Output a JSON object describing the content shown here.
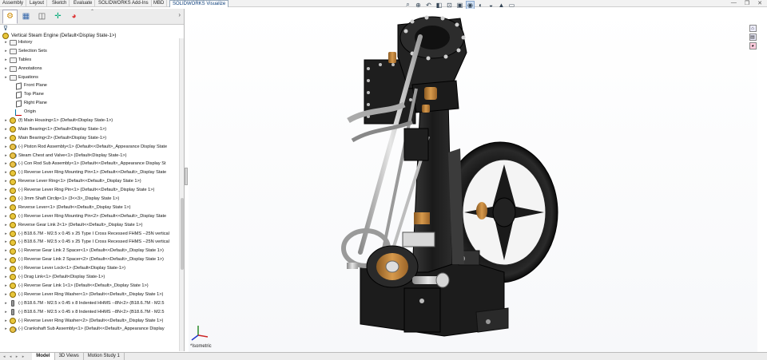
{
  "ribbon": {
    "tabs": [
      "Assembly",
      "Layout",
      "Sketch",
      "Evaluate",
      "SOLIDWORKS Add-Ins",
      "MBD",
      "SOLIDWORKS Visualize"
    ],
    "active_tab": "SOLIDWORKS Visualize"
  },
  "heads_up_toolbar": {
    "icons": [
      "zoom-to-fit-icon",
      "zoom-area-icon",
      "previous-view-icon",
      "section-view-icon",
      "dynamic-annotation-icon",
      "view-orientation-icon",
      "display-style-icon",
      "hide-show-items-icon",
      "edit-appearance-icon",
      "apply-scene-icon",
      "view-settings-icon"
    ]
  },
  "feature_manager": {
    "tabs": [
      "feature-manager-icon",
      "property-manager-icon",
      "configuration-manager-icon",
      "dimxpert-manager-icon",
      "display-manager-icon"
    ],
    "root": "Vertical Steam Engine  (Default<Display State-1>)",
    "items": [
      {
        "label": "History",
        "icon": "folder",
        "level": 1,
        "expandable": true
      },
      {
        "label": "Selection Sets",
        "icon": "folder",
        "level": 1,
        "expandable": true
      },
      {
        "label": "Tables",
        "icon": "folder",
        "level": 1,
        "expandable": true
      },
      {
        "label": "Annotations",
        "icon": "folder",
        "level": 1,
        "expandable": true
      },
      {
        "label": "Equations",
        "icon": "folder",
        "level": 1,
        "expandable": true
      },
      {
        "label": "Front Plane",
        "icon": "plane",
        "level": 2,
        "expandable": false
      },
      {
        "label": "Top Plane",
        "icon": "plane",
        "level": 2,
        "expandable": false
      },
      {
        "label": "Right Plane",
        "icon": "plane",
        "level": 2,
        "expandable": false
      },
      {
        "label": "Origin",
        "icon": "origin",
        "level": 2,
        "expandable": false
      },
      {
        "label": "(f) Main Housing<1> (Default<Display State-1>)",
        "icon": "gear",
        "level": 1,
        "expandable": true
      },
      {
        "label": "Main Bearing<1> (Default<Display State-1>)",
        "icon": "gear",
        "level": 1,
        "expandable": true
      },
      {
        "label": "Main Bearing<2> (Default<Display State-1>)",
        "icon": "gear",
        "level": 1,
        "expandable": true
      },
      {
        "label": "(-) Piston Rod Assembly<1> (Default<<Default>_Appearance Display State",
        "icon": "sub",
        "level": 1,
        "expandable": true
      },
      {
        "label": "Steam Chest and Valve<1> (Default<Display State-1>)",
        "icon": "sub",
        "level": 1,
        "expandable": true
      },
      {
        "label": "(-) Con Rod Sub Assembly<1> (Default<<Default>_Appearance Display St",
        "icon": "sub",
        "level": 1,
        "expandable": true
      },
      {
        "label": "(-) Reverse Lever Ring Mounting Pin<1> (Default<<Default>_Display State",
        "icon": "gear",
        "level": 1,
        "expandable": true
      },
      {
        "label": "Reverse Lever Ring<1> (Default<<Default>_Display State 1>)",
        "icon": "gear",
        "level": 1,
        "expandable": true
      },
      {
        "label": "(-) Reverse Lever Ring Pin<1> (Default<<Default>_Display State 1>)",
        "icon": "gear",
        "level": 1,
        "expandable": true
      },
      {
        "label": "(-) 3mm Shaft Circlip<1> (3<<3>_Display State 1>)",
        "icon": "gear",
        "level": 1,
        "expandable": true
      },
      {
        "label": "Reverse Lever<1> (Default<<Default>_Display State 1>)",
        "icon": "gear",
        "level": 1,
        "expandable": true
      },
      {
        "label": "(-) Reverse Lever Ring Mounting Pin<2> (Default<<Default>_Display State",
        "icon": "gear",
        "level": 1,
        "expandable": true
      },
      {
        "label": "Reverse Gear Link 2<1> (Default<<Default>_Display State 1>)",
        "icon": "gear",
        "level": 1,
        "expandable": true
      },
      {
        "label": "(-) B18.6.7M - M2.5 x 0.45 x 25 Type I Cross Recessed FHMS --25N vertical",
        "icon": "gear",
        "level": 1,
        "expandable": true
      },
      {
        "label": "(-) B18.6.7M - M2.5 x 0.45 x 25 Type I Cross Recessed FHMS --25N vertical",
        "icon": "gear",
        "level": 1,
        "expandable": true
      },
      {
        "label": "(-) Reverse Gear Link 2 Spacer<1> (Default<<Default>_Display State 1>)",
        "icon": "gear",
        "level": 1,
        "expandable": true
      },
      {
        "label": "(-) Reverse Gear Link 2 Spacer<2> (Default<<Default>_Display State 1>)",
        "icon": "gear",
        "level": 1,
        "expandable": true
      },
      {
        "label": "(-) Reverse Lever Lock<1> (Default<Display State-1>)",
        "icon": "gear",
        "level": 1,
        "expandable": true
      },
      {
        "label": "(-) Drag Link<1> (Default<Display State-1>)",
        "icon": "gear",
        "level": 1,
        "expandable": true
      },
      {
        "label": "(-) Reverse Gear Link 1<1> (Default<<Default>_Display State 1>)",
        "icon": "gear",
        "level": 1,
        "expandable": true
      },
      {
        "label": "(-) Reverse Lever Ring Washer<1> (Default<<Default>_Display State 1>)",
        "icon": "gear",
        "level": 1,
        "expandable": true
      },
      {
        "label": "(-) B18.6.7M - M2.5 x 0.45 x 8 Indented HHMS --8N<2> (B18.6.7M - M2.5",
        "icon": "bolt",
        "level": 1,
        "expandable": true
      },
      {
        "label": "(-) B18.6.7M - M2.5 x 0.45 x 8 Indented HHMS --8N<2> (B18.6.7M - M2.5",
        "icon": "bolt",
        "level": 1,
        "expandable": true
      },
      {
        "label": "(-) Reverse Lever Ring Washer<2> (Default<<Default>_Display State 1>)",
        "icon": "gear",
        "level": 1,
        "expandable": true
      },
      {
        "label": "(-) Crankshaft Sub Assembly<1> (Default<<Default>_Appearance Display",
        "icon": "sub",
        "level": 1,
        "expandable": true
      }
    ]
  },
  "bottom_tabs": [
    "Model",
    "3D Views",
    "Motion Study 1"
  ],
  "active_bottom_tab": "Model",
  "view_label": "*Isometric",
  "task_pane": [
    "home-icon",
    "design-library-icon",
    "appearances-icon"
  ],
  "colors": {
    "accent": "#0a3d7a",
    "metal_dark": "#1e1e1e",
    "brass": "#c98a3a",
    "steel": "#b9b9b9",
    "selection": "#cfe0f4"
  }
}
